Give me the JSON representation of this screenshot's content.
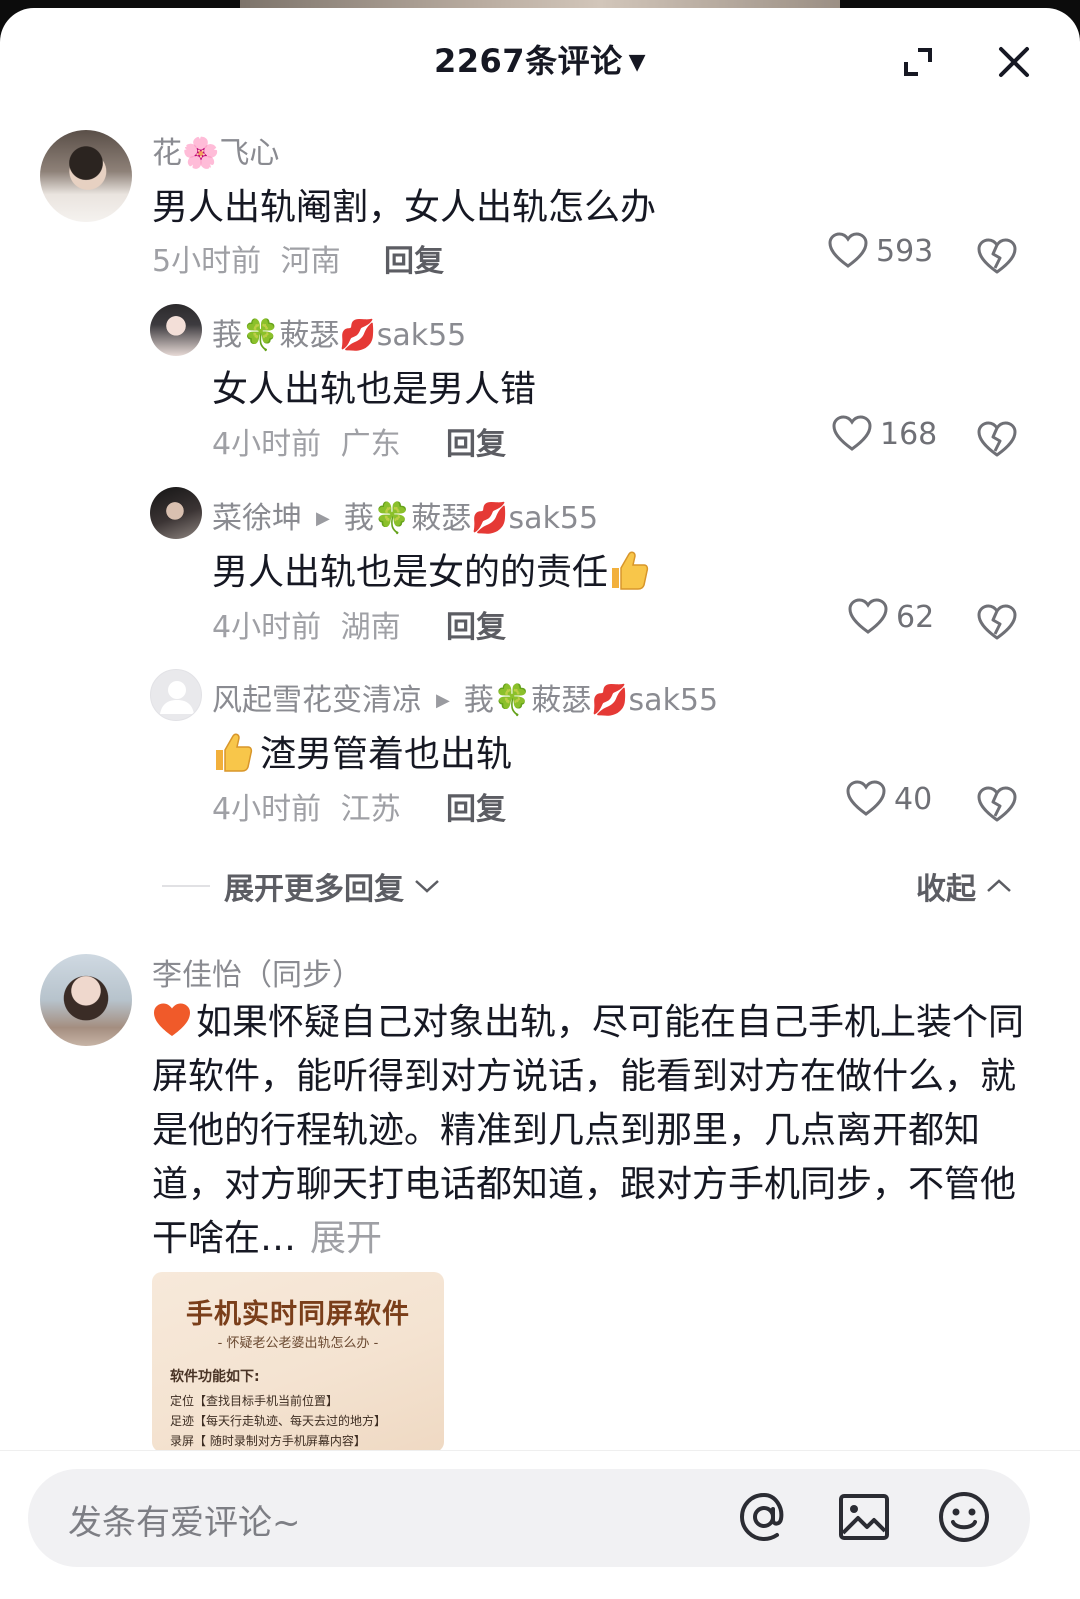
{
  "header": {
    "title": "2267条评论"
  },
  "comments": [
    {
      "username": "花🌸飞心",
      "text": "男人出轨阉割，女人出轨怎么办",
      "time": "5小时前",
      "location": "河南",
      "reply_label": "回复",
      "likes": "593"
    }
  ],
  "replies": [
    {
      "username": "莪🍀蓛瑟💋sak55",
      "text": "女人出轨也是男人错",
      "time": "4小时前",
      "location": "广东",
      "reply_label": "回复",
      "likes": "168"
    },
    {
      "username": "菜徐坤",
      "reply_to": "莪🍀蓛瑟💋sak55",
      "text": "男人出轨也是女的的责任",
      "time": "4小时前",
      "location": "湖南",
      "reply_label": "回复",
      "likes": "62"
    },
    {
      "username": "风起雪花变清凉",
      "reply_to": "莪🍀蓛瑟💋sak55",
      "text": "渣男管着也出轨",
      "time": "4小时前",
      "location": "江苏",
      "reply_label": "回复",
      "likes": "40"
    }
  ],
  "thread_controls": {
    "expand_more": "展开更多回复",
    "collapse": "收起"
  },
  "second_comment": {
    "username": "李佳怡（同步）",
    "text": "如果怀疑自己对象出轨，尽可能在自己手机上装个同屏软件，能听得到对方说话，能看到对方在做什么，就是他的行程轨迹。精准到几点到那里，几点离开都知道，对方聊天打电话都知道，跟对方手机同步，不管他干啥在…",
    "expand_label": "展开",
    "attachment": {
      "title": "手机实时同屏软件",
      "subtitle": "- 怀疑老公老婆出轨怎么办 -",
      "features_heading": "软件功能如下:",
      "features": [
        "定位【查找目标手机当前位置】",
        "足迹【每天行走轨迹、每天去过的地方】",
        "录屏【 随时录制对方手机屏幕内容】"
      ]
    }
  },
  "input": {
    "placeholder": "发条有爱评论~"
  },
  "icons": {
    "expand": "expand-icon",
    "close": "close-icon",
    "heart": "heart-outline-icon",
    "dislike": "broken-heart-icon",
    "at": "at-mention-icon",
    "image": "image-icon",
    "emoji": "emoji-face-icon"
  }
}
